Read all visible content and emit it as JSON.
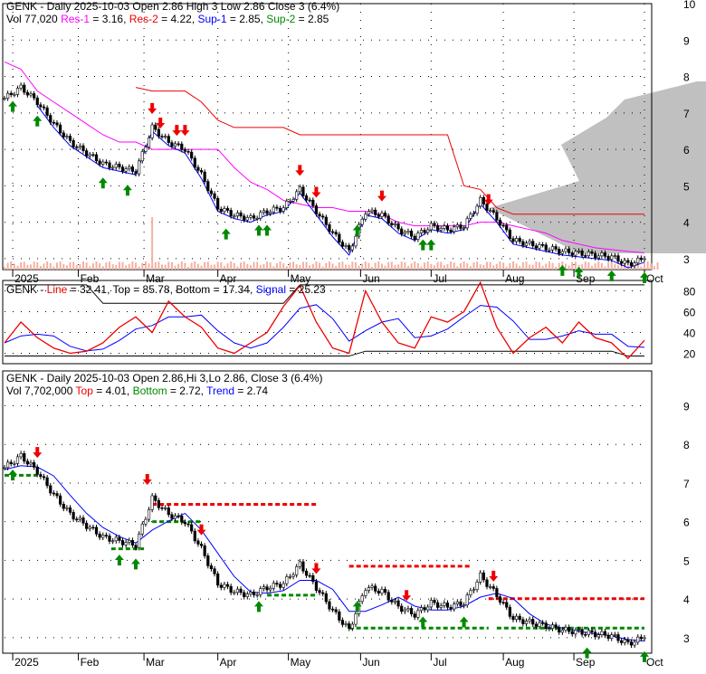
{
  "chart_data": [
    {
      "type": "candlestick",
      "title": "GENK - Daily 2025-10-03 Open 2.86  High 3  Low 2.86  Close 3 (6.4%)",
      "legend": {
        "vol": "Vol 77,020",
        "res1": "Res-1",
        "res1_val": " = 3.16, ",
        "res2": "Res-2",
        "res2_val": " = 4.22, ",
        "sup1": "Sup-1",
        "sup1_val": " = 2.85, ",
        "sup2": "Sup-2",
        "sup2_val": " = 2.85"
      },
      "ylim": [
        2.7,
        10
      ],
      "yticks": [
        "10",
        "9",
        "8",
        "7",
        "6",
        "5",
        "4",
        "3"
      ],
      "closes": [
        7.4,
        7.7,
        7.3,
        6.7,
        6.2,
        5.9,
        5.6,
        5.5,
        5.4,
        6.6,
        6.2,
        6.0,
        5.3,
        4.4,
        4.2,
        4.1,
        4.3,
        4.4,
        4.9,
        4.3,
        3.7,
        3.2,
        4.3,
        4.2,
        3.8,
        3.6,
        3.9,
        3.8,
        3.9,
        4.6,
        4.1,
        3.5,
        3.4,
        3.3,
        3.2,
        3.15,
        3.1,
        3.05,
        2.85,
        3.0
      ],
      "res1": [
        8.4,
        8.2,
        7.6,
        7.3,
        7.0,
        6.7,
        6.4,
        6.2,
        6.2,
        6.0,
        6.0,
        6.0,
        6.0,
        6.0,
        5.5,
        5.1,
        4.9,
        4.6,
        4.5,
        4.4,
        4.4,
        4.3,
        4.3,
        4.2,
        4.0,
        3.9,
        3.9,
        3.9,
        3.9,
        4.0,
        4.0,
        3.9,
        3.8,
        3.7,
        3.5,
        3.4,
        3.3,
        3.25,
        3.2,
        3.16
      ],
      "res2": [
        null,
        null,
        null,
        null,
        null,
        null,
        null,
        null,
        7.7,
        7.6,
        7.6,
        7.6,
        7.3,
        6.8,
        6.6,
        6.6,
        6.6,
        6.6,
        6.4,
        6.4,
        6.4,
        6.4,
        6.4,
        6.4,
        6.4,
        6.4,
        6.4,
        6.4,
        5.0,
        4.9,
        4.4,
        4.22,
        4.22,
        4.22,
        4.22,
        4.22,
        4.22,
        4.22,
        4.22,
        4.22
      ],
      "buy_weeks": [
        0.5,
        2,
        6,
        7.5,
        13.5,
        15.5,
        16,
        21.5,
        25.5,
        26,
        34,
        35,
        37,
        39
      ],
      "sell_weeks": [
        9,
        9.5,
        10.5,
        11,
        18,
        19,
        23,
        29.5
      ]
    },
    {
      "type": "line",
      "title": "GENK - ",
      "legend": {
        "line": "Line",
        "line_val": " = 32.41, Top = 85.78, Bottom = 17.34, ",
        "signal": "Signal",
        "signal_val": " = 25.23"
      },
      "ylim": [
        10,
        90
      ],
      "yticks": [
        "80",
        "60",
        "40",
        "20"
      ],
      "line": [
        30,
        50,
        35,
        25,
        20,
        22,
        30,
        45,
        55,
        40,
        70,
        55,
        45,
        25,
        20,
        30,
        40,
        65,
        85,
        50,
        25,
        20,
        80,
        50,
        30,
        25,
        55,
        50,
        60,
        88,
        45,
        20,
        35,
        45,
        30,
        50,
        35,
        30,
        15,
        32.41
      ],
      "top": [
        85.78,
        85.78,
        85.78,
        85.78,
        85.78,
        85.78,
        68,
        68,
        68,
        68,
        68,
        68,
        68,
        68,
        68,
        68,
        68,
        68,
        85.78,
        85.78,
        85.78,
        85.78,
        85.78,
        85.78,
        85.78,
        85.78,
        85.78,
        85.78,
        85.78,
        85.78,
        85.78,
        85.78,
        85.78,
        85.78,
        85.78,
        85.78,
        85.78,
        85.78,
        85.78,
        85.78
      ],
      "bottom": [
        17.34,
        17.34,
        17.34,
        17.34,
        17.34,
        17.34,
        17.34,
        17.34,
        17.34,
        17.34,
        17.34,
        17.34,
        17.34,
        17.34,
        17.34,
        17.34,
        17.34,
        17.34,
        17.34,
        17.34,
        17.34,
        17.34,
        22,
        22,
        22,
        22,
        22,
        22,
        22,
        22,
        22,
        22,
        22,
        22,
        22,
        22,
        22,
        22,
        17.34,
        17.34
      ]
    },
    {
      "type": "candlestick",
      "title": "GENK - Daily 2025-10-03 Open 2.86,Hi 3,Lo 2.86, Close 3 (6.4%)",
      "legend": {
        "vol": "Vol 7,702,000 ",
        "top": "Top",
        "top_val": " = 4.01, ",
        "bottom": "Bottom",
        "bottom_val": " = 2.72, ",
        "trend": "Trend",
        "trend_val": " = 2.74"
      },
      "ylim": [
        2.6,
        9.9
      ],
      "yticks": [
        "9",
        "8",
        "7",
        "6",
        "5",
        "4",
        "3"
      ],
      "res_segments": [
        [
          9,
          19,
          6.45
        ],
        [
          21,
          28.5,
          4.85
        ],
        [
          29.5,
          39,
          4.01
        ]
      ],
      "sup_segments": [
        [
          0,
          2,
          7.2
        ],
        [
          6.5,
          8.5,
          5.3
        ],
        [
          9,
          12,
          6.0
        ],
        [
          16,
          19,
          4.1
        ],
        [
          21,
          29.5,
          3.25
        ],
        [
          30,
          39,
          3.25
        ]
      ],
      "buy_weeks": [
        0.5,
        7,
        8,
        15.5,
        21.5,
        25.5,
        28,
        35.5,
        39
      ],
      "sell_weeks": [
        2,
        8.7,
        12,
        19,
        24.5,
        29.8
      ]
    },
    {
      "xlabels": [
        "2025",
        "Feb",
        "Mar",
        "Apr",
        "May",
        "Jun",
        "Jul",
        "Aug",
        "Sep",
        "Oct"
      ],
      "xweeks": [
        0.5,
        4.5,
        8.5,
        13,
        17.3,
        21.7,
        26,
        30.4,
        34.7,
        39
      ]
    }
  ]
}
